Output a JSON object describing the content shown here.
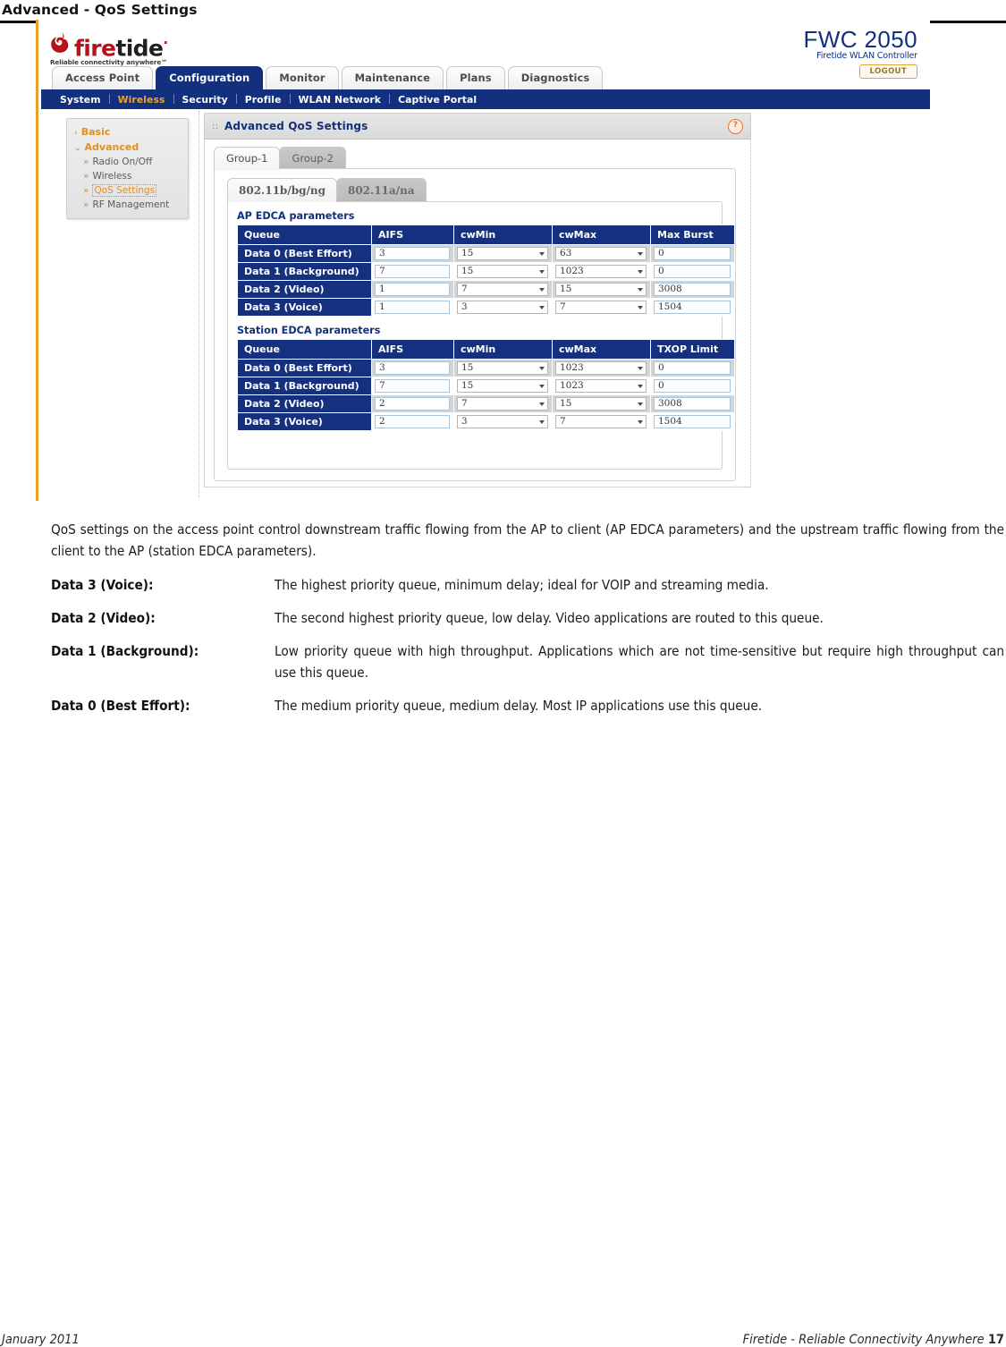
{
  "document": {
    "title": "Advanced - QoS Settings",
    "footer_left": "January 2011",
    "footer_right": "Firetide - Reliable Connectivity Anywhere",
    "page_number": "17"
  },
  "app": {
    "logo": {
      "word_first": "fire",
      "word_second": "tide",
      "trademark": "·",
      "tagline": "Reliable connectivity anywhere™"
    },
    "model": {
      "name": "FWC 2050",
      "subtitle": "Firetide WLAN Controller",
      "logout_label": "LOGOUT"
    },
    "tabs": [
      {
        "label": "Access Point",
        "active": false
      },
      {
        "label": "Configuration",
        "active": true
      },
      {
        "label": "Monitor",
        "active": false
      },
      {
        "label": "Maintenance",
        "active": false
      },
      {
        "label": "Plans",
        "active": false
      },
      {
        "label": "Diagnostics",
        "active": false
      }
    ],
    "subnav": [
      {
        "label": "System",
        "active": false
      },
      {
        "label": "Wireless",
        "active": true
      },
      {
        "label": "Security",
        "active": false
      },
      {
        "label": "Profile",
        "active": false
      },
      {
        "label": "WLAN Network",
        "active": false
      },
      {
        "label": "Captive Portal",
        "active": false
      }
    ],
    "sidebar": {
      "groups": [
        {
          "label": "Basic",
          "arrow": "›",
          "expanded": false,
          "items": []
        },
        {
          "label": "Advanced",
          "arrow": "⌄",
          "expanded": true,
          "items": [
            {
              "label": "Radio On/Off",
              "selected": false
            },
            {
              "label": "Wireless",
              "selected": false
            },
            {
              "label": "QoS Settings",
              "selected": true
            },
            {
              "label": "RF Management",
              "selected": false
            }
          ]
        }
      ],
      "chevron": "»"
    },
    "panel": {
      "dots": "::",
      "title": "Advanced QoS Settings",
      "help_label": "?"
    },
    "group_tabs": [
      {
        "label": "Group-1",
        "active": true
      },
      {
        "label": "Group-2",
        "active": false
      }
    ],
    "radio_tabs": [
      {
        "label": "802.11b/bg/ng",
        "active": true
      },
      {
        "label": "802.11a/na",
        "active": false
      }
    ],
    "ap_edca": {
      "caption": "AP EDCA parameters",
      "headers": [
        "Queue",
        "AIFS",
        "cwMin",
        "cwMax",
        "Max Burst"
      ],
      "rows": [
        {
          "queue": "Data 0 (Best Effort)",
          "aifs": "3",
          "cwmin": "15",
          "cwmax": "63",
          "last": "0"
        },
        {
          "queue": "Data 1 (Background)",
          "aifs": "7",
          "cwmin": "15",
          "cwmax": "1023",
          "last": "0"
        },
        {
          "queue": "Data 2 (Video)",
          "aifs": "1",
          "cwmin": "7",
          "cwmax": "15",
          "last": "3008"
        },
        {
          "queue": "Data 3 (Voice)",
          "aifs": "1",
          "cwmin": "3",
          "cwmax": "7",
          "last": "1504"
        }
      ]
    },
    "station_edca": {
      "caption": "Station EDCA parameters",
      "headers": [
        "Queue",
        "AIFS",
        "cwMin",
        "cwMax",
        "TXOP Limit"
      ],
      "rows": [
        {
          "queue": "Data 0 (Best Effort)",
          "aifs": "3",
          "cwmin": "15",
          "cwmax": "1023",
          "last": "0"
        },
        {
          "queue": "Data 1 (Background)",
          "aifs": "7",
          "cwmin": "15",
          "cwmax": "1023",
          "last": "0"
        },
        {
          "queue": "Data 2 (Video)",
          "aifs": "2",
          "cwmin": "7",
          "cwmax": "15",
          "last": "3008"
        },
        {
          "queue": "Data 3 (Voice)",
          "aifs": "2",
          "cwmin": "3",
          "cwmax": "7",
          "last": "1504"
        }
      ]
    }
  },
  "prose": {
    "intro": "QoS settings on the access point control downstream traffic flowing from the AP to client (AP EDCA parameters) and the upstream traffic flowing from the client to the AP (station EDCA parameters).",
    "definitions": [
      {
        "term": "Data 3 (Voice):",
        "desc": "The highest priority queue, minimum delay; ideal for VOIP and streaming media."
      },
      {
        "term": "Data 2 (Video):",
        "desc": "The second highest priority queue, low delay. Video applications are routed to this queue."
      },
      {
        "term": "Data 1 (Background):",
        "desc": "Low priority queue with high throughput. Applications which are not time-sensitive but require high throughput can use this queue."
      },
      {
        "term": "Data 0 (Best Effort):",
        "desc": "The medium priority queue, medium delay. Most IP applications use this queue."
      }
    ]
  },
  "colors": {
    "brand_navy": "#12307e",
    "brand_red": "#b5121b",
    "accent_orange": "#e38f1d",
    "table_header": "#14307f"
  }
}
